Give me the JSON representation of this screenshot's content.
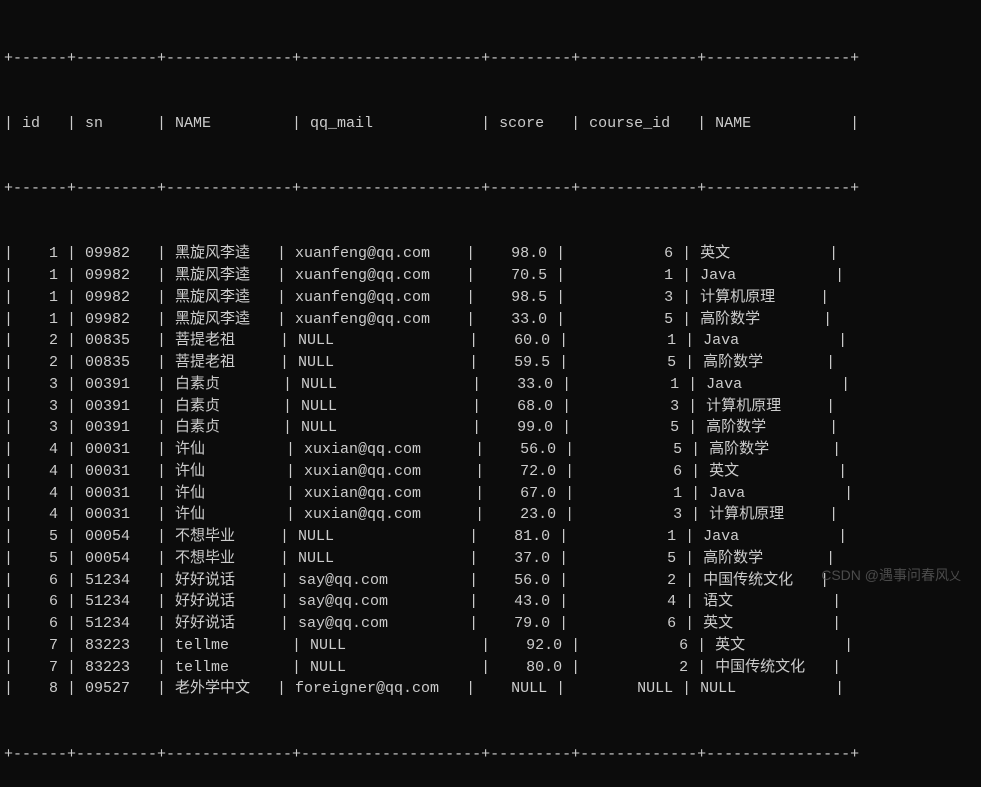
{
  "columns": [
    {
      "name": "id",
      "width": 4,
      "align": "right"
    },
    {
      "name": "sn",
      "width": 7,
      "align": "left"
    },
    {
      "name": "NAME",
      "width": 12,
      "align": "left"
    },
    {
      "name": "qq_mail",
      "width": 18,
      "align": "left"
    },
    {
      "name": "score",
      "width": 7,
      "align": "right"
    },
    {
      "name": "course_id",
      "width": 11,
      "align": "right"
    },
    {
      "name": "NAME",
      "width": 14,
      "align": "left"
    }
  ],
  "rows": [
    {
      "id": "1",
      "sn": "09982",
      "name1": "黑旋风李逵",
      "qq_mail": "xuanfeng@qq.com",
      "score": "98.0",
      "course_id": "6",
      "name2": "英文"
    },
    {
      "id": "1",
      "sn": "09982",
      "name1": "黑旋风李逵",
      "qq_mail": "xuanfeng@qq.com",
      "score": "70.5",
      "course_id": "1",
      "name2": "Java"
    },
    {
      "id": "1",
      "sn": "09982",
      "name1": "黑旋风李逵",
      "qq_mail": "xuanfeng@qq.com",
      "score": "98.5",
      "course_id": "3",
      "name2": "计算机原理"
    },
    {
      "id": "1",
      "sn": "09982",
      "name1": "黑旋风李逵",
      "qq_mail": "xuanfeng@qq.com",
      "score": "33.0",
      "course_id": "5",
      "name2": "高阶数学"
    },
    {
      "id": "2",
      "sn": "00835",
      "name1": "菩提老祖",
      "qq_mail": "NULL",
      "score": "60.0",
      "course_id": "1",
      "name2": "Java"
    },
    {
      "id": "2",
      "sn": "00835",
      "name1": "菩提老祖",
      "qq_mail": "NULL",
      "score": "59.5",
      "course_id": "5",
      "name2": "高阶数学"
    },
    {
      "id": "3",
      "sn": "00391",
      "name1": "白素贞",
      "qq_mail": "NULL",
      "score": "33.0",
      "course_id": "1",
      "name2": "Java"
    },
    {
      "id": "3",
      "sn": "00391",
      "name1": "白素贞",
      "qq_mail": "NULL",
      "score": "68.0",
      "course_id": "3",
      "name2": "计算机原理"
    },
    {
      "id": "3",
      "sn": "00391",
      "name1": "白素贞",
      "qq_mail": "NULL",
      "score": "99.0",
      "course_id": "5",
      "name2": "高阶数学"
    },
    {
      "id": "4",
      "sn": "00031",
      "name1": "许仙",
      "qq_mail": "xuxian@qq.com",
      "score": "56.0",
      "course_id": "5",
      "name2": "高阶数学"
    },
    {
      "id": "4",
      "sn": "00031",
      "name1": "许仙",
      "qq_mail": "xuxian@qq.com",
      "score": "72.0",
      "course_id": "6",
      "name2": "英文"
    },
    {
      "id": "4",
      "sn": "00031",
      "name1": "许仙",
      "qq_mail": "xuxian@qq.com",
      "score": "67.0",
      "course_id": "1",
      "name2": "Java"
    },
    {
      "id": "4",
      "sn": "00031",
      "name1": "许仙",
      "qq_mail": "xuxian@qq.com",
      "score": "23.0",
      "course_id": "3",
      "name2": "计算机原理"
    },
    {
      "id": "5",
      "sn": "00054",
      "name1": "不想毕业",
      "qq_mail": "NULL",
      "score": "81.0",
      "course_id": "1",
      "name2": "Java"
    },
    {
      "id": "5",
      "sn": "00054",
      "name1": "不想毕业",
      "qq_mail": "NULL",
      "score": "37.0",
      "course_id": "5",
      "name2": "高阶数学"
    },
    {
      "id": "6",
      "sn": "51234",
      "name1": "好好说话",
      "qq_mail": "say@qq.com",
      "score": "56.0",
      "course_id": "2",
      "name2": "中国传统文化"
    },
    {
      "id": "6",
      "sn": "51234",
      "name1": "好好说话",
      "qq_mail": "say@qq.com",
      "score": "43.0",
      "course_id": "4",
      "name2": "语文"
    },
    {
      "id": "6",
      "sn": "51234",
      "name1": "好好说话",
      "qq_mail": "say@qq.com",
      "score": "79.0",
      "course_id": "6",
      "name2": "英文"
    },
    {
      "id": "7",
      "sn": "83223",
      "name1": "tellme",
      "qq_mail": "NULL",
      "score": "92.0",
      "course_id": "6",
      "name2": "英文"
    },
    {
      "id": "7",
      "sn": "83223",
      "name1": "tellme",
      "qq_mail": "NULL",
      "score": "80.0",
      "course_id": "2",
      "name2": "中国传统文化"
    },
    {
      "id": "8",
      "sn": "09527",
      "name1": "老外学中文",
      "qq_mail": "foreigner@qq.com",
      "score": "NULL",
      "course_id": "NULL",
      "name2": "NULL"
    }
  ],
  "watermark": {
    "prefix": "CSDN @遇事问春风",
    "icon": "乂"
  }
}
